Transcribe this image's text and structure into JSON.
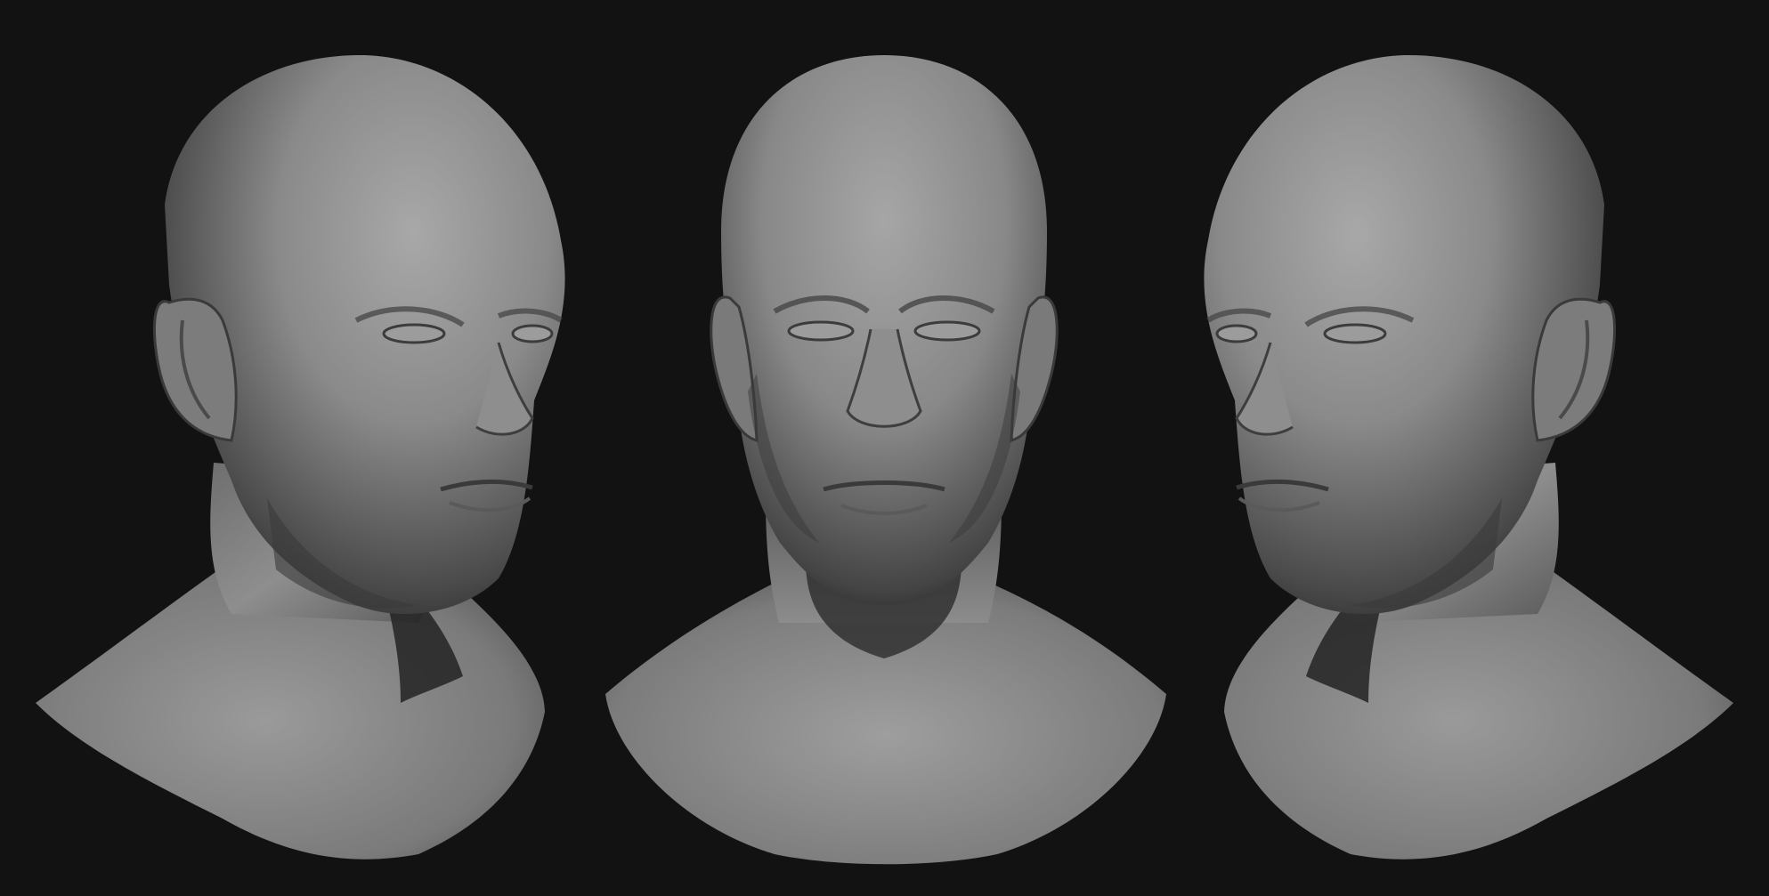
{
  "scene": {
    "background_color": "#121212",
    "material_color": "#8a8a8a",
    "subject": "sculpted-head-bust",
    "views": [
      {
        "id": "three-quarter-right",
        "name": "bust-three-quarter-right"
      },
      {
        "id": "front",
        "name": "bust-front"
      },
      {
        "id": "three-quarter-left",
        "name": "bust-three-quarter-left"
      }
    ]
  }
}
